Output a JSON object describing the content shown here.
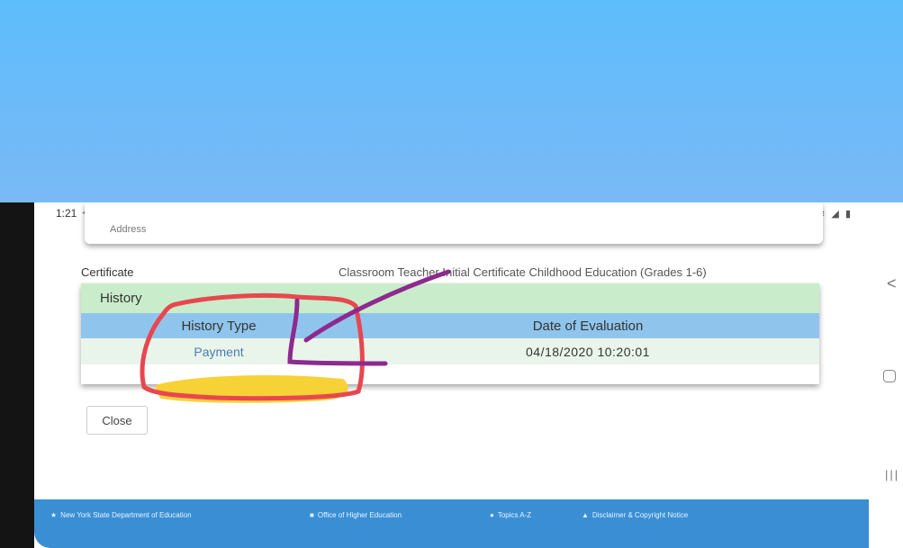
{
  "status_bar": {
    "time": "1:21",
    "left_icons": "⌖ ▣ ◉ ▭ ▬ ♀",
    "right_icons": "▣ ≋ ◢ ▮"
  },
  "top_card": {
    "clipped_text": "Address"
  },
  "certificate": {
    "label": "Certificate",
    "value": "Classroom Teacher Initial Certificate Childhood Education (Grades 1-6)"
  },
  "history": {
    "title": "History",
    "columns": [
      "History Type",
      "Date of Evaluation"
    ],
    "rows": [
      {
        "type": "Payment",
        "date": "04/18/2020 10:20:01"
      }
    ]
  },
  "close_label": "Close",
  "footer": {
    "links": [
      {
        "icon": "star-icon",
        "label": "New York State Department of Education"
      },
      {
        "icon": "lock-icon",
        "label": "Office of Higher Education"
      },
      {
        "icon": "question-icon",
        "label": "Topics A-Z"
      },
      {
        "icon": "warning-icon",
        "label": "Disclaimer & Copyright Notice"
      }
    ]
  },
  "android_nav": {
    "back": "<",
    "recent": "|||"
  },
  "colors": {
    "sky_top": "#5ebdfb",
    "history_header_bg": "#c9eccb",
    "table_header_bg": "#8fc5ec",
    "row_bg": "#e9f5ea",
    "footer_bg": "#3a8fd4",
    "annotation_red": "#e8474f",
    "annotation_purple": "#8e2a8f",
    "annotation_yellow": "#f6d237"
  }
}
